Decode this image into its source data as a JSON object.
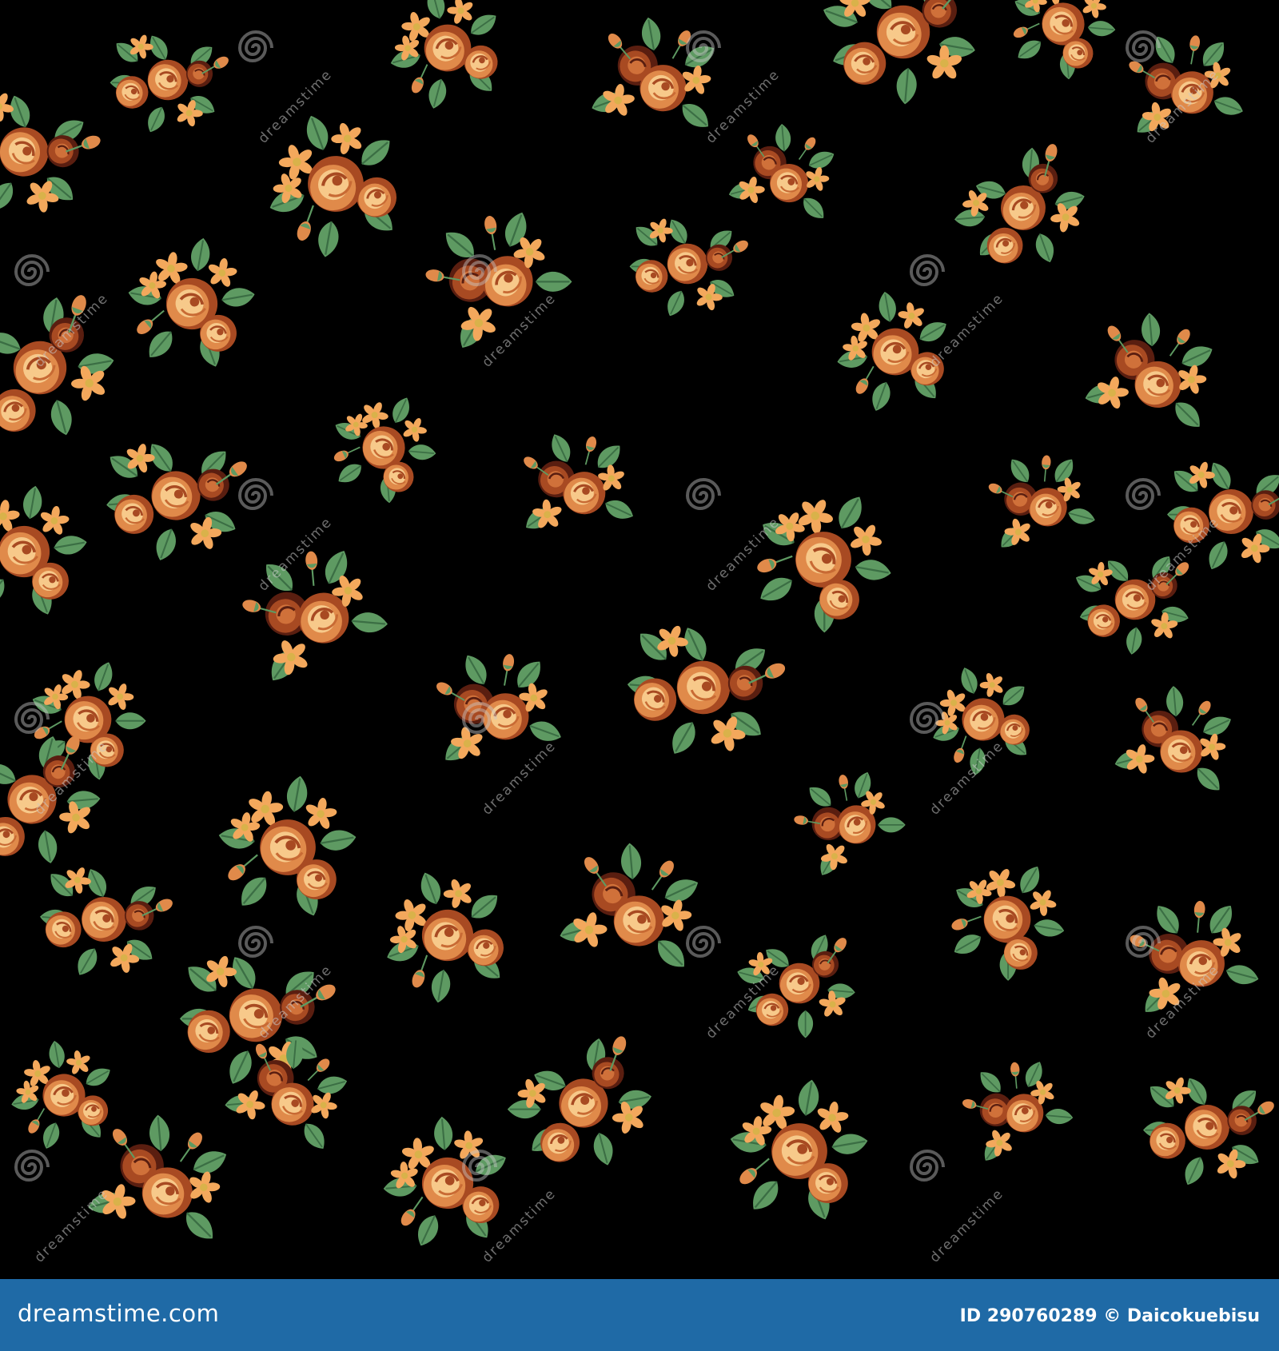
{
  "image": {
    "subject": "Seamless floral pattern of small orange and peach roses with green leaves on a black background",
    "palette": {
      "background": "#000000",
      "rose_light": "#f7c98a",
      "rose_mid": "#e08a4a",
      "rose_dark": "#a84a22",
      "rose_shadow": "#5a1e10",
      "leaf": "#5e9a62",
      "leaf_dark": "#3b6e44",
      "daisy": "#f3a85c",
      "daisy_center": "#d9b24a"
    }
  },
  "watermark": {
    "text": "dreamstime",
    "icon": "swirl-icon"
  },
  "footer": {
    "brand": "dreamstime.com",
    "id_label": "ID",
    "id_value": "290760289",
    "copyright_symbol": "©",
    "author": "Daicokuebisu",
    "background": "#1f6aa6"
  }
}
